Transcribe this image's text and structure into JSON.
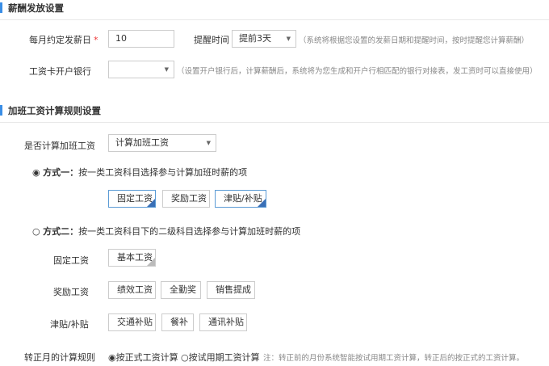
{
  "section1": {
    "title": "薪酬发放设置",
    "payday_label": "每月约定发薪日",
    "payday_required": "*",
    "payday_value": "10",
    "reminder_label": "提醒时间",
    "reminder_value": "提前3天",
    "reminder_hint": "（系统将根据您设置的发薪日期和提醒时间，按时提醒您计算薪酬）",
    "bank_label": "工资卡开户银行",
    "bank_value": "",
    "bank_hint": "（设置开户银行后，计算薪酬后，系统将为您生成和开户行相匹配的银行对接表，发工资时可以直接使用）"
  },
  "section2": {
    "title": "加班工资计算规则设置",
    "calc_label": "是否计算加班工资",
    "calc_value": "计算加班工资",
    "method1_radio": "◉",
    "method1_title": "方式一：",
    "method1_desc": "按一类工资科目选择参与计算加班时薪的项",
    "method1_chips": [
      "固定工资",
      "奖励工资",
      "津贴/补贴"
    ],
    "method2_radio": "○",
    "method2_title": "方式二：",
    "method2_desc": "按一类工资科目下的二级科目选择参与计算加班时薪的项",
    "groups": [
      {
        "label": "固定工资",
        "chips": [
          "基本工资"
        ]
      },
      {
        "label": "奖励工资",
        "chips": [
          "绩效工资",
          "全勤奖",
          "销售提成"
        ]
      },
      {
        "label": "津贴/补贴",
        "chips": [
          "交通补贴",
          "餐补",
          "通讯补贴"
        ]
      }
    ],
    "probation_label": "转正月的计算规则",
    "probation_opt1": "◉按正式工资计算",
    "probation_opt2": "○按试用期工资计算",
    "probation_note": "注：转正前的月份系统智能按试用期工资计算，转正后的按正式的工资计算。"
  }
}
